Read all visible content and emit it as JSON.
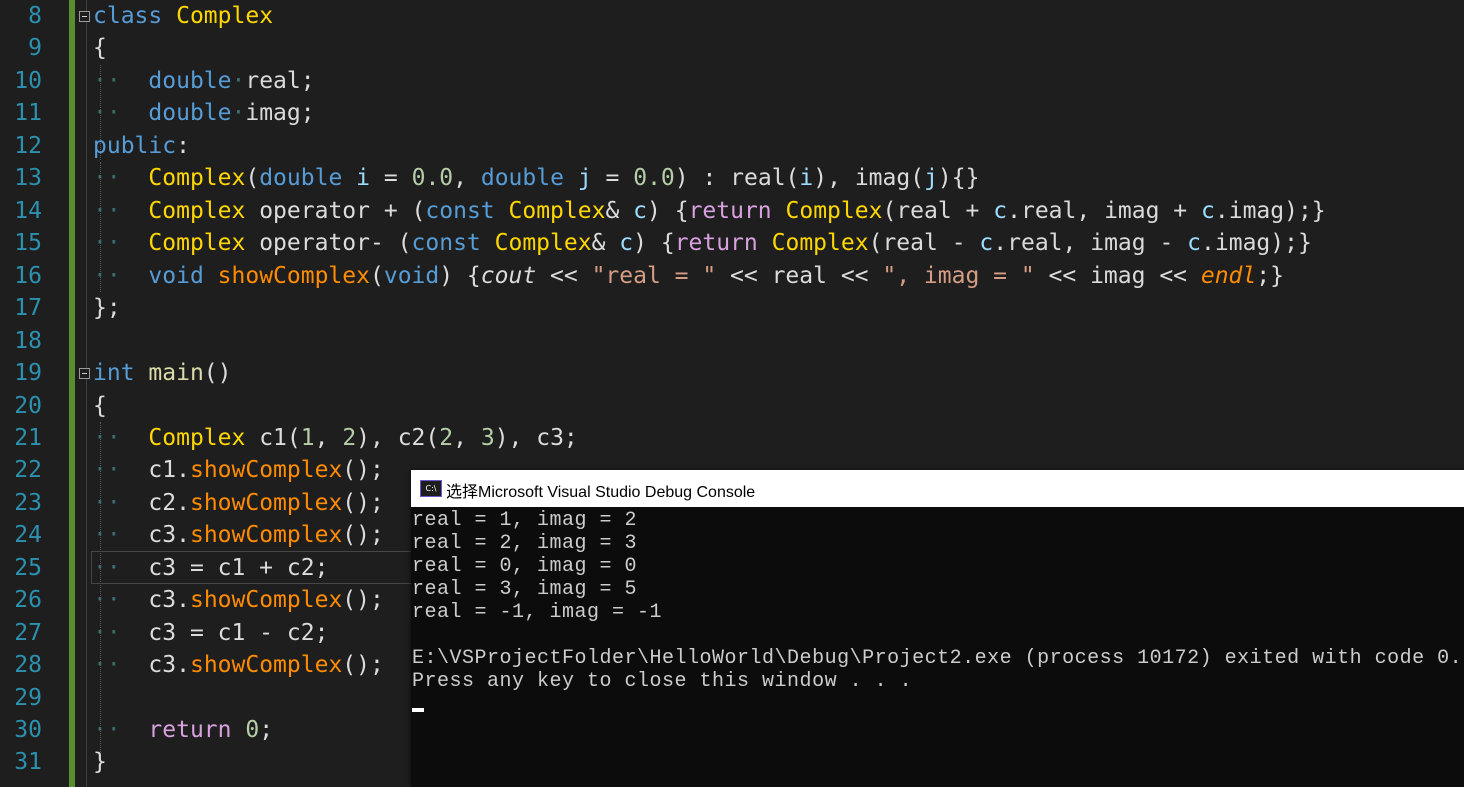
{
  "editor": {
    "line_numbers": [
      "8",
      "9",
      "10",
      "11",
      "12",
      "13",
      "14",
      "15",
      "16",
      "17",
      "18",
      "19",
      "20",
      "21",
      "22",
      "23",
      "24",
      "25",
      "26",
      "27",
      "28",
      "29",
      "30",
      "31"
    ],
    "code": {
      "l8": {
        "kw": "class",
        "name": "Complex"
      },
      "l9": "{",
      "l10": {
        "type": "double",
        "name": "real",
        "end": ";"
      },
      "l11": {
        "type": "double",
        "name": "imag",
        "end": ";"
      },
      "l12": {
        "kw": "public",
        "end": ":"
      },
      "l13": {
        "ctor": "Complex",
        "t1": "double",
        "p1": "i",
        "eq": "=",
        "v1": "0.0",
        "c": ",",
        "t2": "double",
        "p2": "j",
        "v2": "0.0",
        "rest": ") : ",
        "m1": "real",
        "a1": "i",
        "m2": "imag",
        "a2": "j",
        "body": "{}"
      },
      "l14": {
        "type": "Complex",
        "op": "operator",
        "sym": "+",
        "const": "const",
        "ptype": "Complex",
        "param": "c",
        "ret": "return",
        "rtype": "Complex",
        "m1": "real",
        "m2": "imag",
        "mem1": "real",
        "mem2": "imag"
      },
      "l15": {
        "type": "Complex",
        "op": "operator-",
        "sym": "-",
        "const": "const",
        "ptype": "Complex",
        "param": "c",
        "ret": "return",
        "rtype": "Complex",
        "m1": "real",
        "m2": "imag",
        "mem1": "real",
        "mem2": "imag"
      },
      "l16": {
        "void": "void",
        "fn": "showComplex",
        "argvoid": "void",
        "cout": "cout",
        "s1": "\"real = \"",
        "m1": "real",
        "s2": "\", imag = \"",
        "m2": "imag",
        "endl": "endl"
      },
      "l17": "};",
      "l19": {
        "type": "int",
        "fn": "main",
        "paren": "()"
      },
      "l20": "{",
      "l21": {
        "type": "Complex",
        "rest": [
          "c1(",
          "1",
          ", ",
          "2",
          "), c2(",
          "2",
          ", ",
          "3",
          "), c3;"
        ]
      },
      "l22": {
        "obj": "c1",
        "fn": "showComplex"
      },
      "l23": {
        "obj": "c2",
        "fn": "showComplex"
      },
      "l24": {
        "obj": "c3",
        "fn": "showComplex"
      },
      "l25": "c3 = c1 + c2;",
      "l26": {
        "obj": "c3",
        "fn": "showComplex"
      },
      "l27": "c3 = c1 - c2;",
      "l28": {
        "obj": "c3",
        "fn": "showComplex"
      },
      "l30": {
        "ret": "return",
        "val": "0"
      },
      "l31": "}"
    }
  },
  "console": {
    "title": "选择Microsoft Visual Studio Debug Console",
    "icon_label": "C:\\",
    "lines": [
      "real = 1, imag = 2",
      "real = 2, imag = 3",
      "real = 0, imag = 0",
      "real = 3, imag = 5",
      "real = -1, imag = -1",
      "",
      "E:\\VSProjectFolder\\HelloWorld\\Debug\\Project2.exe (process 10172) exited with code 0.",
      "Press any key to close this window . . ."
    ]
  }
}
